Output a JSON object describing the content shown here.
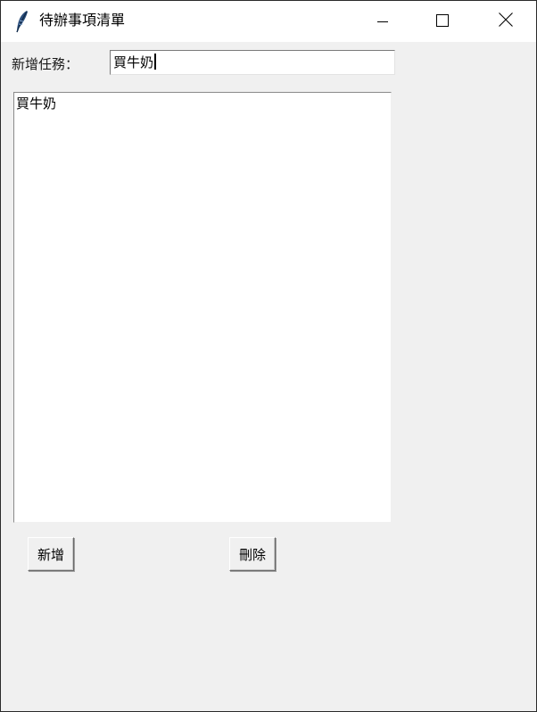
{
  "window": {
    "title": "待辦事項清單",
    "icon": "feather-icon",
    "controls": [
      "minimize-icon",
      "maximize-icon",
      "close-icon"
    ]
  },
  "form": {
    "label": "新增任務：",
    "entry_value": "買牛奶"
  },
  "tasks": {
    "items": [
      "買牛奶"
    ]
  },
  "buttons": {
    "add_label": "新增",
    "delete_label": "刪除"
  }
}
